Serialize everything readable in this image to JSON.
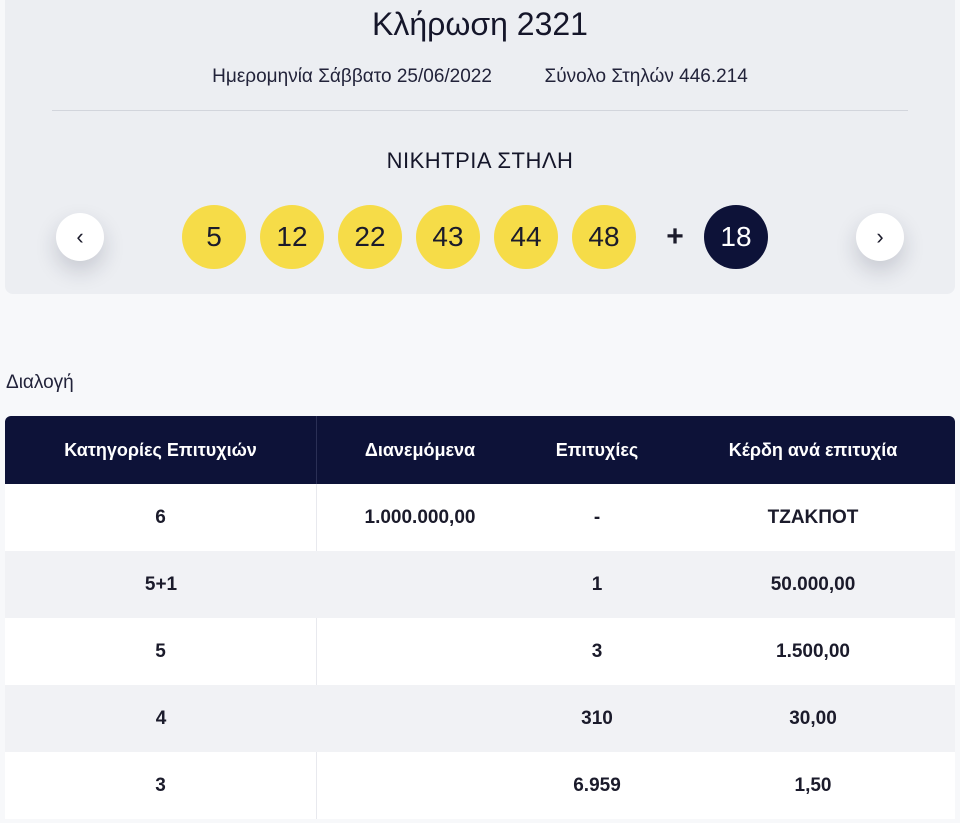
{
  "draw": {
    "title": "Κλήρωση 2321",
    "date_label": "Ημερομηνία",
    "date_value": "Σάββατο 25/06/2022",
    "total_label": "Σύνολο Στηλών",
    "total_value": "446.214",
    "winning_label": "ΝΙΚΗΤΡΙΑ ΣΤΗΛΗ",
    "numbers": [
      "5",
      "12",
      "22",
      "43",
      "44",
      "48"
    ],
    "plus": "+",
    "joker": "18",
    "prev_icon": "‹",
    "next_icon": "›"
  },
  "filter_label": "Διαλογή",
  "table": {
    "headers": [
      "Κατηγορίες Επιτυχιών",
      "Διανεμόμενα",
      "Επιτυχίες",
      "Κέρδη ανά επιτυχία"
    ],
    "rows": [
      [
        "6",
        "1.000.000,00",
        "-",
        "ΤΖΑΚΠΟΤ"
      ],
      [
        "5+1",
        "",
        "1",
        "50.000,00"
      ],
      [
        "5",
        "",
        "3",
        "1.500,00"
      ],
      [
        "4",
        "",
        "310",
        "30,00"
      ],
      [
        "3",
        "",
        "6.959",
        "1,50"
      ]
    ]
  },
  "colors": {
    "ball_main": "#f6dc48",
    "ball_joker": "#0d1238",
    "table_header": "#0d1238"
  }
}
